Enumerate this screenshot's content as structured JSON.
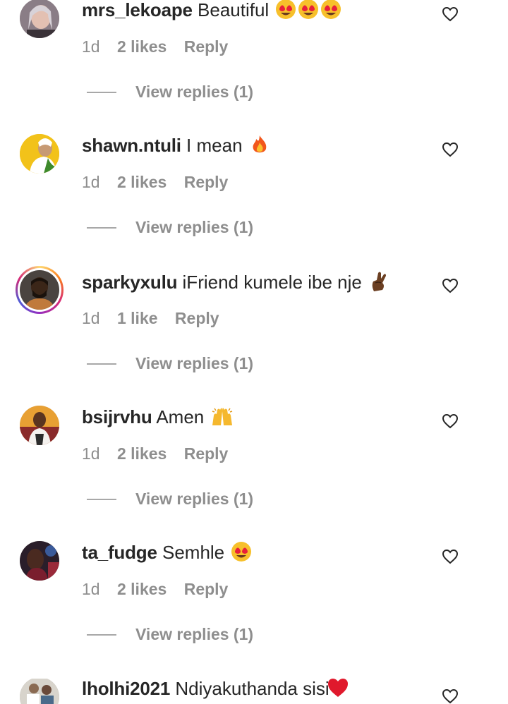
{
  "comments": [
    {
      "username": "mrs_lekoape",
      "text": "Beautiful",
      "emoji": "heart-eyes x3",
      "time": "1d",
      "likes": "2 likes",
      "reply": "Reply",
      "view_replies": "View replies (1)",
      "avatar": "avatar-woman"
    },
    {
      "username": "shawn.ntuli",
      "text": "I mean",
      "emoji": "fire",
      "time": "1d",
      "likes": "2 likes",
      "reply": "Reply",
      "view_replies": "View replies (1)",
      "avatar": "avatar-yellow"
    },
    {
      "username": "sparkyxulu",
      "text": "iFriend kumele ibe nje",
      "emoji": "crossed-fingers",
      "time": "1d",
      "likes": "1 like",
      "reply": "Reply",
      "view_replies": "View replies (1)",
      "avatar": "avatar-story-ring"
    },
    {
      "username": "bsijrvhu",
      "text": "Amen",
      "emoji": "raised-hands",
      "time": "1d",
      "likes": "2 likes",
      "reply": "Reply",
      "view_replies": "View replies (1)",
      "avatar": "avatar-orange"
    },
    {
      "username": "ta_fudge",
      "text": "Semhle",
      "emoji": "heart-eyes",
      "time": "1d",
      "likes": "2 likes",
      "reply": "Reply",
      "view_replies": "View replies (1)",
      "avatar": "avatar-dark"
    },
    {
      "username": "lholhi2021",
      "text": "Ndiyakuthanda sisi",
      "emoji": "red-heart",
      "avatar": "avatar-group"
    }
  ],
  "colors": {
    "text": "#262626",
    "muted": "#8e8e8e",
    "line": "#a8a8a8"
  }
}
